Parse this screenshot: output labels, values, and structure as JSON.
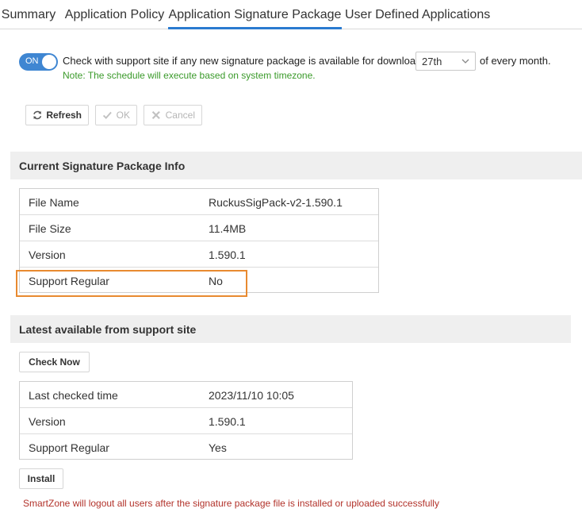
{
  "tabs": [
    {
      "label": "Summary",
      "active": false
    },
    {
      "label": "Application Policy",
      "active": false
    },
    {
      "label": "Application Signature Package",
      "active": true
    },
    {
      "label": "User Defined Applications",
      "active": false
    }
  ],
  "schedule": {
    "toggle_label": "ON",
    "toggle_on": true,
    "text": "Check with support site if any new signature package is available for download on",
    "day_value": "27th",
    "suffix": "of every month.",
    "note": "Note: The schedule will execute based on system timezone."
  },
  "toolbar": {
    "refresh_label": "Refresh",
    "ok_label": "OK",
    "cancel_label": "Cancel"
  },
  "current": {
    "title": "Current Signature Package Info",
    "rows": [
      {
        "key": "File Name",
        "value": "RuckusSigPack-v2-1.590.1"
      },
      {
        "key": "File Size",
        "value": "11.4MB"
      },
      {
        "key": "Version",
        "value": "1.590.1"
      },
      {
        "key": "Support Regular",
        "value": "No"
      }
    ]
  },
  "latest": {
    "title": "Latest available from support site",
    "check_now_label": "Check Now",
    "rows": [
      {
        "key": "Last checked time",
        "value": "2023/11/10 10:05"
      },
      {
        "key": "Version",
        "value": "1.590.1"
      },
      {
        "key": "Support Regular",
        "value": "Yes"
      }
    ],
    "install_label": "Install",
    "warning": "SmartZone will logout all users after the signature package file is installed or uploaded successfully"
  },
  "colors": {
    "accent": "#3f86d2",
    "highlight": "#e88a30",
    "note": "#3a9a2a",
    "warning": "#b2322a"
  }
}
